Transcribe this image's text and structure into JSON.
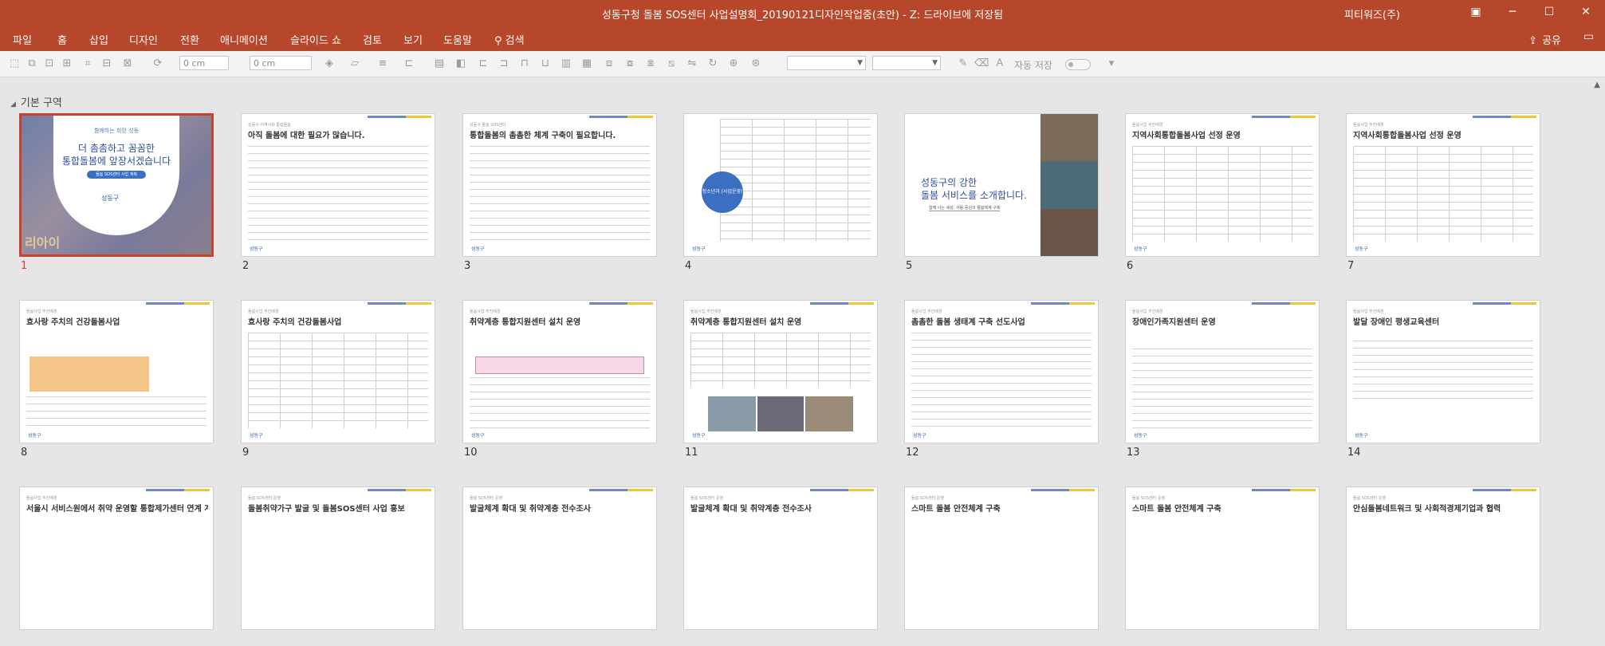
{
  "window": {
    "title": "성동구청 돌봄 SOS센터 사업설명회_20190121디자인작업중(초안)  -  Z: 드라이브에 저장됨",
    "user": "피티워즈(주)",
    "controls": {
      "ribbon_icon": "▣",
      "minimize": "─",
      "maximize": "☐",
      "close": "✕"
    }
  },
  "menu": {
    "items": [
      "파일",
      "홈",
      "삽입",
      "디자인",
      "전환",
      "애니메이션",
      "슬라이드 쇼",
      "검토",
      "보기",
      "도움말"
    ],
    "search_label": "검색",
    "share_label": "공유"
  },
  "toolbar": {
    "width_value": "0 cm",
    "height_value": "0 cm",
    "autosave_label": "자동 저장"
  },
  "sorter": {
    "section_label": "기본 구역",
    "slides": [
      {
        "num": "1",
        "sub": "함께하는 희망 성동",
        "lines": [
          "더 촘촘하고 꼼꼼한",
          "통합돌봄에 앞장서겠습니다"
        ],
        "pill": "돌봄 SOS센터 사업 계획",
        "logo": "성동구",
        "bg_text": "리아이"
      },
      {
        "num": "2",
        "sub": "성동구 지역사회 통합돌봄",
        "title": "아직 돌봄에 대한 필요가 많습니다.",
        "logo": "성동구"
      },
      {
        "num": "3",
        "sub": "성동구 돌봄 SOS센터",
        "title": "통합돌봄의 촘촘한 체계 구축이 필요합니다.",
        "logo": "성동구"
      },
      {
        "num": "4",
        "circle_label": "청소년과 (사업운영)",
        "logo": "성동구"
      },
      {
        "num": "5",
        "heading": [
          "성동구의 강한",
          "돌봄 서비스를 소개합니다."
        ],
        "subline": "함께 사는 세상, 사람 중심의 돌봄체계 구축"
      },
      {
        "num": "6",
        "sub": "돌봄사업 추진배경",
        "title": "지역사회통합돌봄사업 선정 운영",
        "logo": "성동구"
      },
      {
        "num": "7",
        "sub": "돌봄사업 추진배경",
        "title": "지역사회통합돌봄사업 선정 운영",
        "logo": "성동구"
      },
      {
        "num": "8",
        "sub": "돌봄사업 추진배경",
        "title": "효사랑 주치의 건강돌봄사업",
        "logo": "성동구"
      },
      {
        "num": "9",
        "sub": "돌봄사업 추진배경",
        "title": "효사랑 주치의 건강돌봄사업",
        "logo": "성동구"
      },
      {
        "num": "10",
        "sub": "돌봄사업 추진배경",
        "title": "취약계층 통합지원센터 설치 운영",
        "logo": "성동구"
      },
      {
        "num": "11",
        "sub": "돌봄사업 추진배경",
        "title": "취약계층 통합지원센터 설치 운영",
        "logo": "성동구"
      },
      {
        "num": "12",
        "sub": "돌봄사업 추진배경",
        "title": "촘촘한 돌봄 생태계 구축 선도사업",
        "logo": "성동구"
      },
      {
        "num": "13",
        "sub": "돌봄사업 추진배경",
        "title": "장애인가족지원센터 운영",
        "logo": "성동구"
      },
      {
        "num": "14",
        "sub": "돌봄사업 추진배경",
        "title": "발달 장애인 평생교육센터",
        "logo": "성동구"
      },
      {
        "num": "15",
        "sub": "돌봄사업 추진배경",
        "title": "서울시 서비스원에서 취약 운영할 통합제가센터 연계 계획"
      },
      {
        "num": "16",
        "sub": "돌봄 SOS센터 운영",
        "title": "돌봄취약가구 발굴 및 돌봄SOS센터 사업 홍보"
      },
      {
        "num": "17",
        "sub": "돌봄 SOS센터 운영",
        "title": "발굴체계 확대 및 취약계층 전수조사"
      },
      {
        "num": "18",
        "sub": "돌봄 SOS센터 운영",
        "title": "발굴체계 확대 및 취약계층 전수조사"
      },
      {
        "num": "19",
        "sub": "돌봄 SOS센터 운영",
        "title": "스마트 돌봄 안전체계 구축"
      },
      {
        "num": "20",
        "sub": "돌봄 SOS센터 운영",
        "title": "스마트 돌봄 안전체계 구축"
      },
      {
        "num": "21",
        "sub": "돌봄 SOS센터 운영",
        "title": "안심돌봄네트워크 및 사회적경제기업과 협력"
      }
    ]
  }
}
